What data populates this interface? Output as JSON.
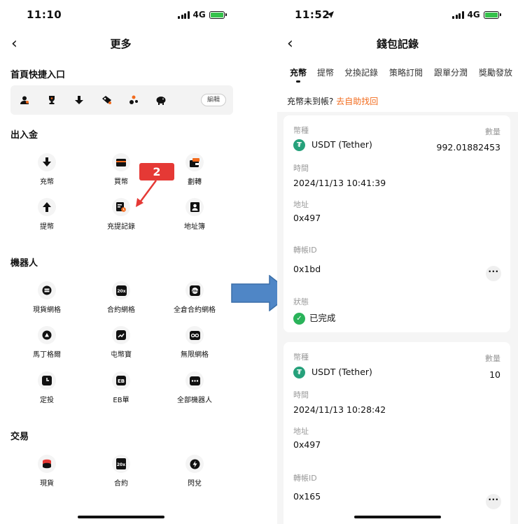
{
  "left": {
    "status": {
      "time": "11:10",
      "network": "4G"
    },
    "title": "更多",
    "shortcut_section": {
      "title": "首頁快捷入口",
      "edit_label": "編輯"
    },
    "funds": {
      "title": "出入金",
      "items": [
        {
          "label": "充幣",
          "icon": "deposit-arrow-icon"
        },
        {
          "label": "買幣",
          "icon": "card-icon"
        },
        {
          "label": "劃轉",
          "icon": "transfer-wallet-icon"
        },
        {
          "label": "提幣",
          "icon": "withdraw-arrow-icon"
        },
        {
          "label": "充提記錄",
          "icon": "record-clock-icon"
        },
        {
          "label": "地址簿",
          "icon": "address-book-icon"
        }
      ]
    },
    "bots": {
      "title": "機器人",
      "items": [
        {
          "label": "現貨網格",
          "icon": "spot-grid-icon"
        },
        {
          "label": "合約網格",
          "icon": "futures-grid-icon",
          "glyph": "20x"
        },
        {
          "label": "全倉合約網格",
          "icon": "cross-futures-grid-icon",
          "glyph": "20x"
        },
        {
          "label": "馬丁格爾",
          "icon": "martingale-icon"
        },
        {
          "label": "屯幣寶",
          "icon": "chart-trend-icon"
        },
        {
          "label": "無限網格",
          "icon": "infinity-icon"
        },
        {
          "label": "定投",
          "icon": "recurring-buy-icon"
        },
        {
          "label": "EB單",
          "icon": "eb-order-icon",
          "glyph": "EB"
        },
        {
          "label": "全部機器人",
          "icon": "all-bots-icon"
        }
      ]
    },
    "trade": {
      "title": "交易",
      "items": [
        {
          "label": "現貨",
          "icon": "spot-coins-icon"
        },
        {
          "label": "合約",
          "icon": "contract-icon",
          "glyph": "20x"
        },
        {
          "label": "閃兌",
          "icon": "flash-swap-icon"
        }
      ]
    },
    "annotation": "2"
  },
  "right": {
    "status": {
      "time": "11:52",
      "network": "4G"
    },
    "title": "錢包記錄",
    "tabs": [
      "充幣",
      "提幣",
      "兌換記錄",
      "策略訂閱",
      "跟單分潤",
      "獎勵發放"
    ],
    "notice": {
      "text": "充幣未到帳?",
      "link": "去自助找回"
    },
    "labels": {
      "coin": "幣種",
      "amount": "數量",
      "time": "時間",
      "address": "地址",
      "txid": "轉帳ID",
      "status": "狀態"
    },
    "records": [
      {
        "coin": "USDT (Tether)",
        "amount": "992.01882453",
        "time": "2024/11/13 10:41:39",
        "address": "0x497",
        "txid": "0x1bd",
        "status": "已完成"
      },
      {
        "coin": "USDT (Tether)",
        "amount": "10",
        "time": "2024/11/13 10:28:42",
        "address": "0x497",
        "txid": "0x165"
      }
    ]
  },
  "colors": {
    "accent_orange": "#f26b1d",
    "annotation_red": "#e53935",
    "tether_green": "#26a17b",
    "success_green": "#2ab35a",
    "arrow_blue": "#4f86c6"
  }
}
